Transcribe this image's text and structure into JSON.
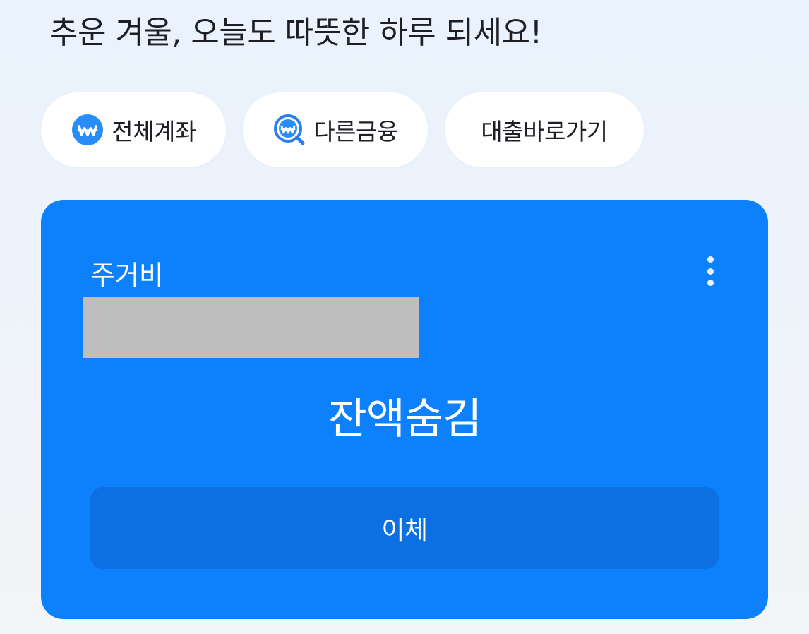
{
  "greeting": "추운 겨울, 오늘도 따뜻한 하루 되세요!",
  "chips": {
    "all_accounts": {
      "label": "전체계좌",
      "icon": "won-coin-icon"
    },
    "other_finance": {
      "label": "다른금융",
      "icon": "won-search-icon"
    },
    "loan_shortcut": {
      "label": "대출바로가기"
    }
  },
  "account_card": {
    "name": "주거비",
    "balance_text": "잔액숨김",
    "transfer_label": "이체",
    "menu_icon": "more-vertical-icon"
  },
  "colors": {
    "card": "#0d80fb",
    "transfer_button": "#0c6fe2",
    "coin_blue": "#2a8cf7",
    "background": "#e9f2fd"
  }
}
